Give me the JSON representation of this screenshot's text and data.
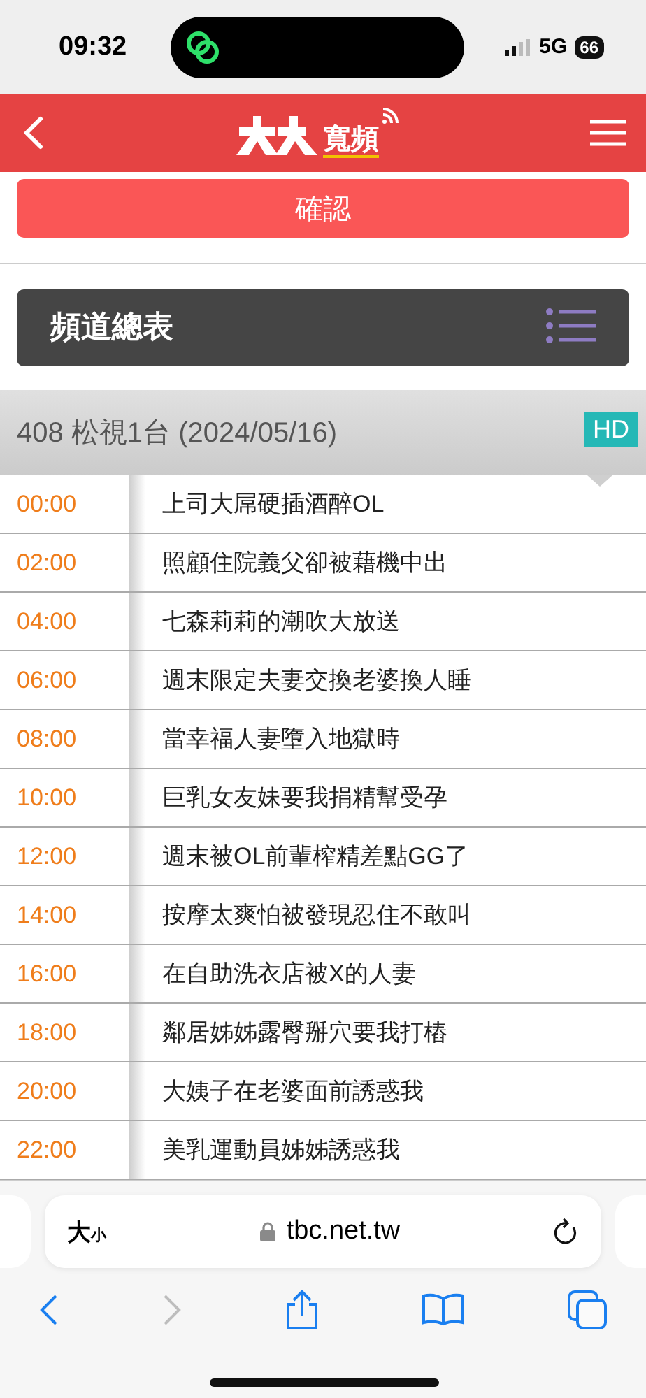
{
  "status_bar": {
    "time": "09:32",
    "network": "5G",
    "battery": "66"
  },
  "header": {
    "logo_text": "寬頻"
  },
  "confirm_button": "確認",
  "channel_list_bar": {
    "title": "頻道總表"
  },
  "channel": {
    "title": "408 松視1台 (2024/05/16)",
    "badge": "HD"
  },
  "schedule": [
    {
      "time": "00:00",
      "program": "上司大屌硬插酒醉OL"
    },
    {
      "time": "02:00",
      "program": "照顧住院義父卻被藉機中出"
    },
    {
      "time": "04:00",
      "program": "七森莉莉的潮吹大放送"
    },
    {
      "time": "06:00",
      "program": "週末限定夫妻交換老婆換人睡"
    },
    {
      "time": "08:00",
      "program": "當幸福人妻墮入地獄時"
    },
    {
      "time": "10:00",
      "program": "巨乳女友妹要我捐精幫受孕"
    },
    {
      "time": "12:00",
      "program": "週末被OL前輩榨精差點GG了"
    },
    {
      "time": "14:00",
      "program": "按摩太爽怕被發現忍住不敢叫"
    },
    {
      "time": "16:00",
      "program": "在自助洗衣店被X的人妻"
    },
    {
      "time": "18:00",
      "program": "鄰居姊姊露臀掰穴要我打樁"
    },
    {
      "time": "20:00",
      "program": "大姨子在老婆面前誘惑我"
    },
    {
      "time": "22:00",
      "program": "美乳運動員姊姊誘惑我"
    }
  ],
  "browser": {
    "text_size_large": "大",
    "text_size_small": "小",
    "url": "tbc.net.tw",
    "forward_enabled": false
  }
}
